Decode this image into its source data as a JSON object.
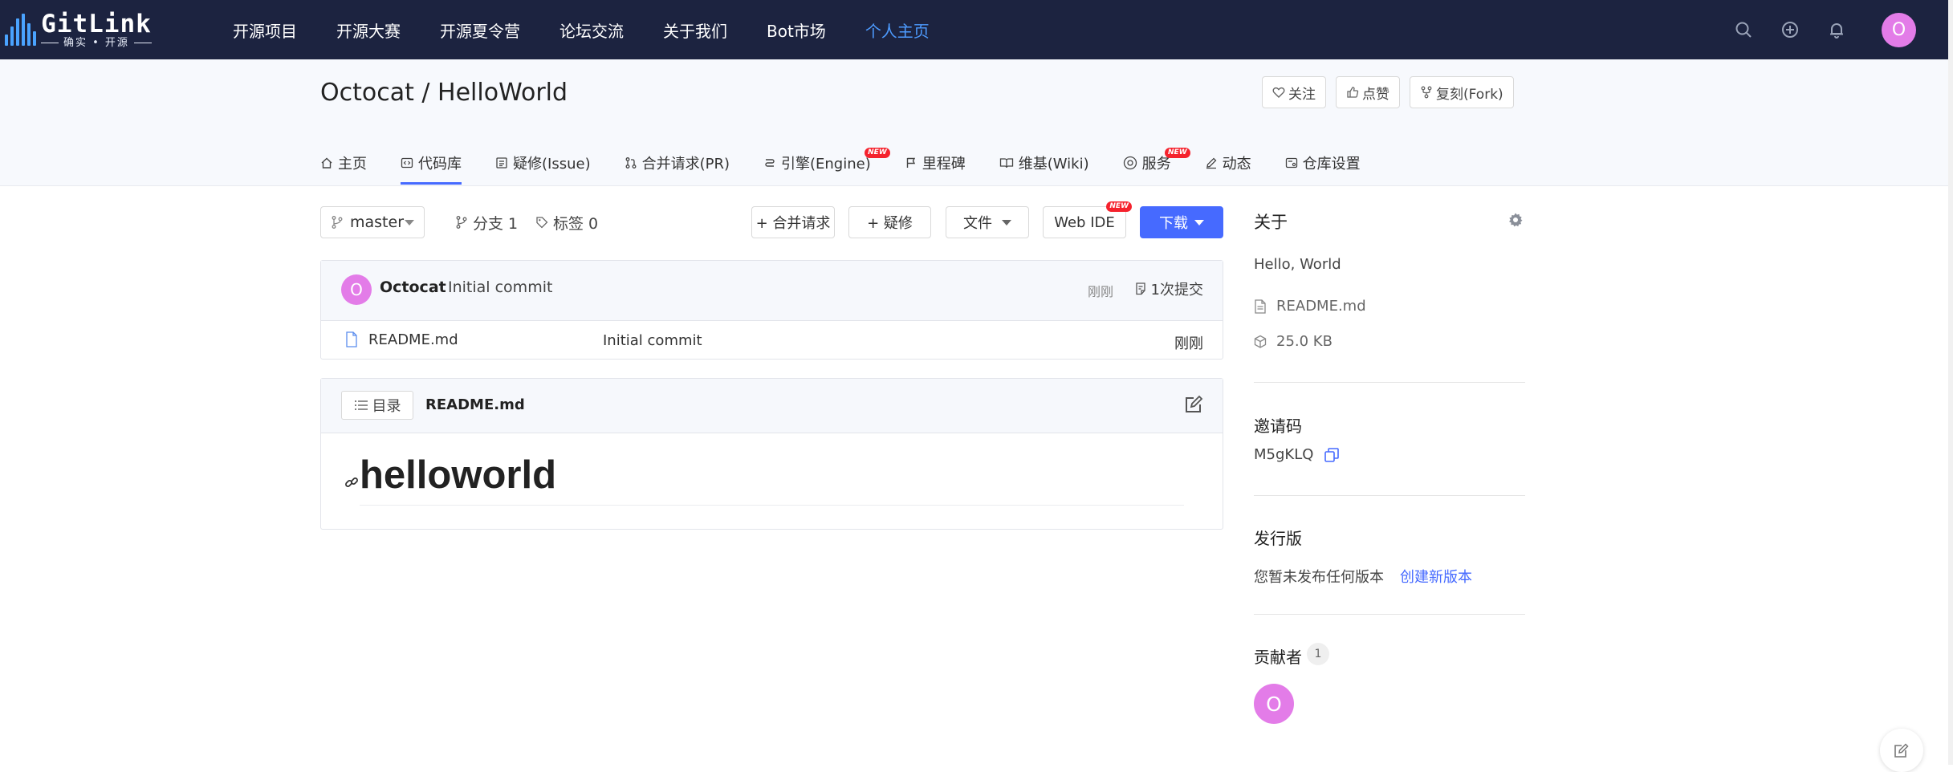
{
  "colors": {
    "nav_bg": "#1c2340",
    "accent": "#466aff",
    "avatar": "#e37ce8",
    "active_nav": "#4d9bff",
    "new_badge": "#f5222d"
  },
  "brand": {
    "title": "GitLink",
    "subtitle": "确实 • 开源"
  },
  "nav": {
    "items": [
      "开源项目",
      "开源大赛",
      "开源夏令营",
      "论坛交流",
      "关于我们",
      "Bot市场",
      "个人主页"
    ],
    "active_index": 6,
    "icons": [
      "search-icon",
      "plus-circle-icon",
      "bell-icon"
    ],
    "avatar_letter": "O"
  },
  "repo": {
    "title": "Octocat / HelloWorld",
    "actions": {
      "watch": "关注",
      "star": "点赞",
      "fork": "复刻(Fork)"
    },
    "tabs": [
      {
        "label": "主页",
        "icon": "home-icon"
      },
      {
        "label": "代码库",
        "icon": "code-icon"
      },
      {
        "label": "疑修(Issue)",
        "icon": "issue-icon"
      },
      {
        "label": "合并请求(PR)",
        "icon": "pull-request-icon"
      },
      {
        "label": "引擎(Engine)",
        "icon": "engine-icon",
        "badge": "NEW"
      },
      {
        "label": "里程碑",
        "icon": "flag-icon"
      },
      {
        "label": "维基(Wiki)",
        "icon": "book-icon"
      },
      {
        "label": "服务",
        "icon": "service-icon",
        "badge": "NEW"
      },
      {
        "label": "动态",
        "icon": "activity-icon"
      },
      {
        "label": "仓库设置",
        "icon": "settings-icon"
      }
    ],
    "active_tab": "代码库"
  },
  "toolbar": {
    "branch": "master",
    "branches": "分支 1",
    "tags": "标签 0",
    "new_pr": "+ 合并请求",
    "new_issue": "+ 疑修",
    "file": "文件",
    "web_ide": "Web IDE",
    "web_ide_badge": "NEW",
    "download": "下载"
  },
  "commit": {
    "avatar_letter": "O",
    "author": "Octocat",
    "message": "Initial commit",
    "time": "刚刚",
    "count": "1次提交"
  },
  "files": [
    {
      "name": "README.md",
      "message": "Initial commit",
      "time": "刚刚"
    }
  ],
  "readme": {
    "toc": "目录",
    "filename": "README.md",
    "heading": "helloworld"
  },
  "sidebar": {
    "about_title": "关于",
    "description": "Hello, World",
    "readme": "README.md",
    "size": "25.0 KB",
    "invite_title": "邀请码",
    "invite_code": "M5gKLQ",
    "release_title": "发行版",
    "release_empty": "您暂未发布任何版本",
    "release_create": "创建新版本",
    "contributors_title": "贡献者",
    "contributors_count": "1",
    "contributor_letter": "O"
  }
}
